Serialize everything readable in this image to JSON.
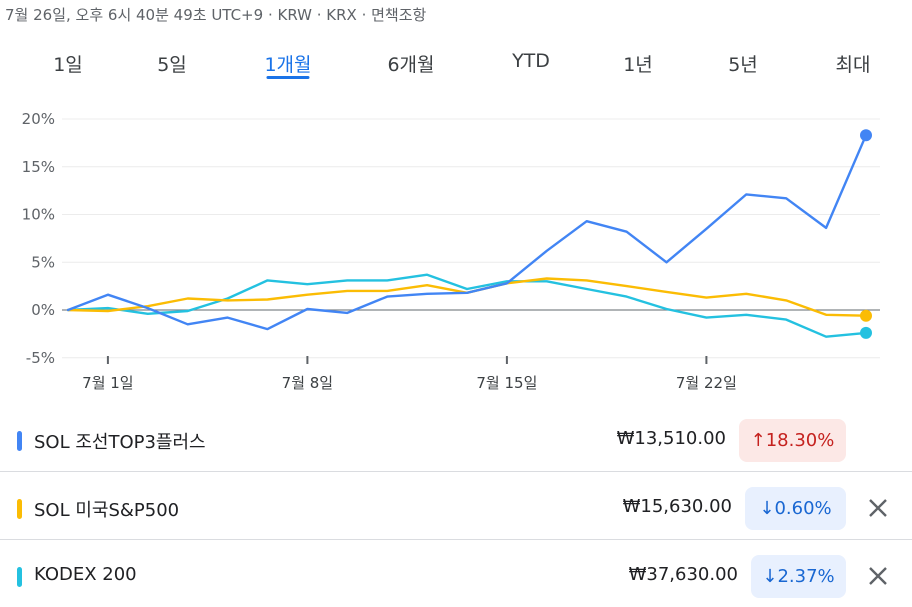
{
  "header": {
    "meta_text": "7월 26일, 오후 6시 40분 49초 UTC+9 · KRW · KRX · 면책조항"
  },
  "tabs": [
    {
      "label": "1일",
      "active": false
    },
    {
      "label": "5일",
      "active": false
    },
    {
      "label": "1개월",
      "active": true
    },
    {
      "label": "6개월",
      "active": false
    },
    {
      "label": "YTD",
      "active": false
    },
    {
      "label": "1년",
      "active": false
    },
    {
      "label": "5년",
      "active": false
    },
    {
      "label": "최대",
      "active": false
    }
  ],
  "chart_data": {
    "type": "line",
    "y_ticks": [
      "20%",
      "15%",
      "10%",
      "5%",
      "0%",
      "-5%"
    ],
    "y_tick_values": [
      20,
      15,
      10,
      5,
      0,
      -5
    ],
    "ylim": [
      -5,
      20
    ],
    "x_ticks": [
      {
        "label": "7월 1일",
        "day": 1
      },
      {
        "label": "7월 8일",
        "day": 8
      },
      {
        "label": "7월 15일",
        "day": 15
      },
      {
        "label": "7월 22일",
        "day": 22
      }
    ],
    "x": [
      26,
      1,
      2,
      3,
      4,
      5,
      8,
      9,
      10,
      11,
      12,
      15,
      16,
      17,
      18,
      19,
      22,
      23,
      24,
      25,
      26
    ],
    "zero_line": true,
    "grid": true,
    "series": [
      {
        "name": "SOL 조선TOP3플러스",
        "color": "#4285f4",
        "values": [
          0,
          1.6,
          0.2,
          -1.5,
          -0.8,
          -2.0,
          0.1,
          -0.3,
          1.4,
          1.7,
          1.8,
          2.8,
          6.2,
          9.3,
          8.2,
          5.0,
          8.5,
          12.1,
          11.7,
          8.6,
          18.3
        ]
      },
      {
        "name": "SOL 미국S&P500",
        "color": "#fbbc04",
        "values": [
          0,
          -0.1,
          0.4,
          1.2,
          1.0,
          1.1,
          1.6,
          2.0,
          2.0,
          2.6,
          1.8,
          2.8,
          3.3,
          3.1,
          2.5,
          1.9,
          1.3,
          1.7,
          1.0,
          -0.5,
          -0.6
        ]
      },
      {
        "name": "KODEX 200",
        "color": "#24c1e0",
        "values": [
          0,
          0.2,
          -0.4,
          -0.1,
          1.2,
          3.1,
          2.7,
          3.1,
          3.1,
          3.7,
          2.2,
          3.0,
          3.0,
          2.2,
          1.4,
          0.1,
          -0.8,
          -0.5,
          -1.0,
          -2.8,
          -2.4
        ]
      }
    ]
  },
  "holdings": [
    {
      "name": "SOL 조선TOP3플러스",
      "color": "#4285f4",
      "price": "₩13,510.00",
      "change": "18.30%",
      "direction": "up",
      "removable": false
    },
    {
      "name": "SOL 미국S&P500",
      "color": "#fbbc04",
      "price": "₩15,630.00",
      "change": "0.60%",
      "direction": "down",
      "removable": true
    },
    {
      "name": "KODEX 200",
      "color": "#24c1e0",
      "price": "₩37,630.00",
      "change": "2.37%",
      "direction": "down",
      "removable": true
    }
  ],
  "icons": {
    "remove": "close-icon",
    "up": "arrow-up-icon",
    "down": "arrow-down-icon"
  }
}
